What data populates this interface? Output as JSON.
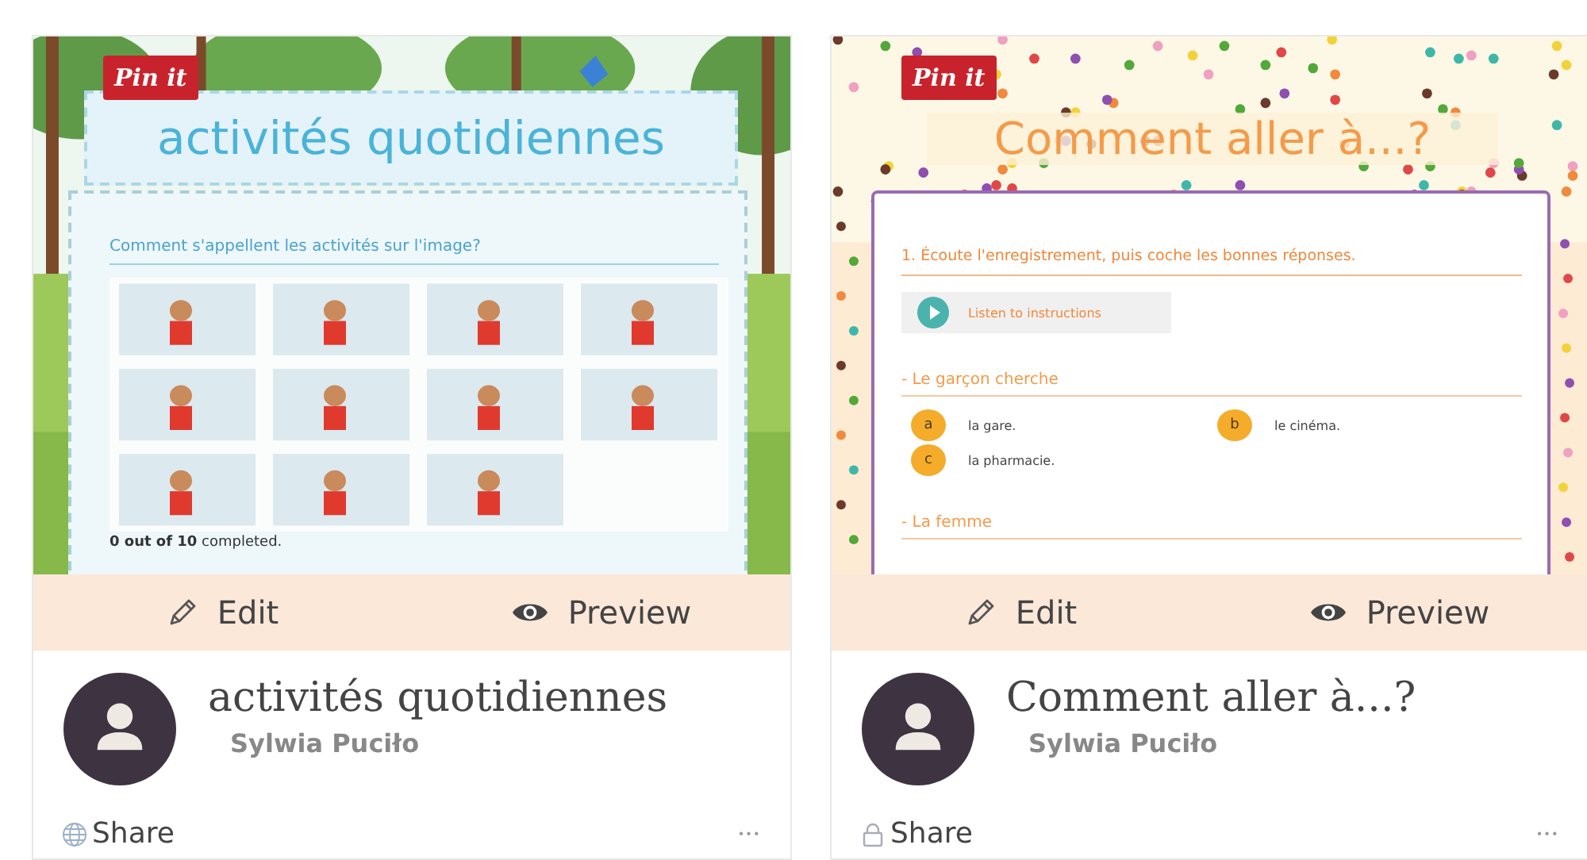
{
  "cards": [
    {
      "preview": {
        "kind": "image-quiz",
        "pin_label": "Pin it",
        "title": "activités quotidiennes",
        "question": "Comment s'appellent les activités sur l'image?",
        "progress": "**0 out of 10** completed."
      },
      "actions": [
        {
          "kind": "edit",
          "label": "Edit"
        },
        {
          "kind": "preview",
          "label": "Preview"
        }
      ],
      "title": "activités quotidiennes",
      "author": "Sylwia Puciło",
      "share": {
        "label": "Share",
        "locked": false
      },
      "more": "•••"
    },
    {
      "preview": {
        "kind": "audio-quiz",
        "pin_label": "Pin it",
        "title": "Comment aller à...?",
        "question": "1. Écoute l'enregistrement, puis coche les bonnes réponses.",
        "audio_label": "Listen to instructions",
        "sections": [
          {
            "heading": "- Le garçon cherche",
            "options": [
              {
                "letter": "a",
                "text": "la gare."
              },
              {
                "letter": "b",
                "text": "le cinéma."
              },
              {
                "letter": "c",
                "text": "la pharmacie."
              }
            ]
          },
          {
            "heading": "- La femme"
          }
        ]
      },
      "actions": [
        {
          "kind": "edit",
          "label": "Edit"
        },
        {
          "kind": "preview",
          "label": "Preview"
        }
      ],
      "title": "Comment aller à...?",
      "author": "Sylwia Puciło",
      "share": {
        "label": "Share",
        "locked": true
      },
      "more": "•••"
    }
  ]
}
